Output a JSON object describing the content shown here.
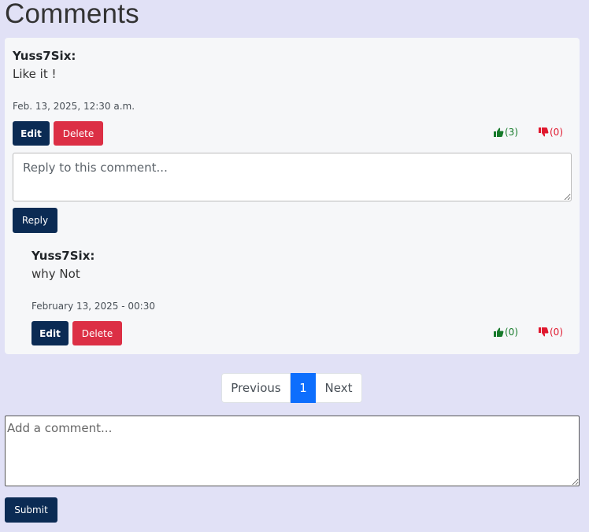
{
  "page": {
    "title": "Comments"
  },
  "comment": {
    "author": "Yuss7Six:",
    "text": "Like it !",
    "date": "Feb. 13, 2025, 12:30 a.m.",
    "edit_label": "Edit",
    "delete_label": "Delete",
    "likes": "(3)",
    "dislikes": "(0)",
    "reply_placeholder": "Reply to this comment...",
    "reply_label": "Reply"
  },
  "reply": {
    "author": "Yuss7Six:",
    "text": "why Not",
    "date": "February 13, 2025 - 00:30",
    "edit_label": "Edit",
    "delete_label": "Delete",
    "likes": "(0)",
    "dislikes": "(0)"
  },
  "pagination": {
    "previous": "Previous",
    "current": "1",
    "next": "Next"
  },
  "new_comment": {
    "placeholder": "Add a comment...",
    "submit_label": "Submit"
  },
  "colors": {
    "primary": "#0b2b54",
    "danger": "#dc2f45",
    "like": "#167a2a",
    "dislike": "#e0192f",
    "active_page": "#0d6efd"
  },
  "icons": {
    "like": "thumbs-up-icon",
    "dislike": "thumbs-down-icon"
  }
}
